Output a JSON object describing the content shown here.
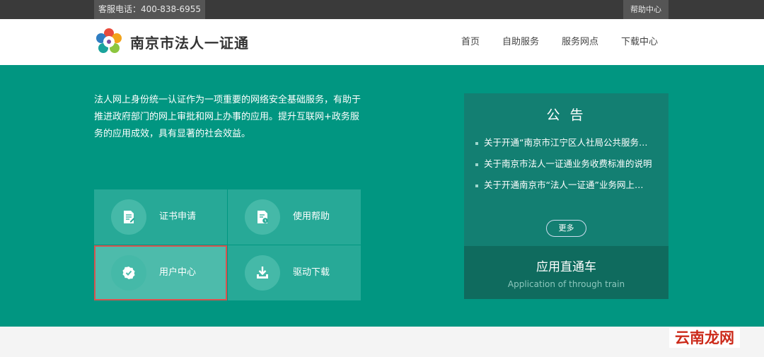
{
  "topbar": {
    "hotline": "客服电话：400-838-6955",
    "help": "帮助中心"
  },
  "header": {
    "brand": "南京市法人一证通",
    "nav": [
      "首页",
      "自助服务",
      "服务网点",
      "下载中心"
    ]
  },
  "intro": "法人网上身份统一认证作为一项重要的网络安全基础服务，有助于推进政府部门的网上审批和网上办事的应用。提升互联网+政务服务的应用成效，具有显著的社会效益。",
  "tiles": [
    {
      "label": "证书申请",
      "icon": "certificate-apply-icon"
    },
    {
      "label": "使用帮助",
      "icon": "help-doc-icon"
    },
    {
      "label": "用户中心",
      "icon": "verified-badge-icon"
    },
    {
      "label": "驱动下载",
      "icon": "download-icon"
    }
  ],
  "notice": {
    "title": "公 告",
    "items": [
      "关于开通“南京市江宁区人社局公共服务…",
      "关于南京市法人一证通业务收费标准的说明",
      "关于开通南京市“法人一证通”业务网上…"
    ],
    "more": "更多"
  },
  "direct": {
    "title": "应用直通车",
    "subtitle": "Application of through train"
  },
  "watermark": "云南龙网",
  "colors": {
    "hero": "#019681",
    "topbar": "#3a3a3a",
    "highlight": "#d9534f"
  }
}
